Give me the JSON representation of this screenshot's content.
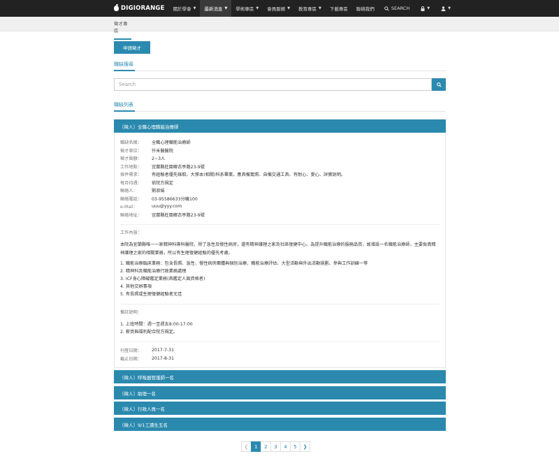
{
  "header": {
    "brand": "DIGIORANGE",
    "nav": [
      {
        "label": "關於學會",
        "caret": true,
        "active": false
      },
      {
        "label": "最新消息",
        "caret": true,
        "active": true
      },
      {
        "label": "學術專區",
        "caret": true,
        "active": false
      },
      {
        "label": "會員服務",
        "caret": true,
        "active": false
      },
      {
        "label": "教育專區",
        "caret": true,
        "active": false
      },
      {
        "label": "下載專區",
        "caret": false,
        "active": false
      },
      {
        "label": "聯絡我們",
        "caret": false,
        "active": false
      }
    ],
    "search_label": "SEARCH"
  },
  "breadcrumb": {
    "label": "徵才專區"
  },
  "apply_button": "申請徵才",
  "search_section": {
    "title": "職缺搜尋",
    "placeholder": "Search"
  },
  "list_section": {
    "title": "職缺列表"
  },
  "jobs": [
    {
      "title": "〔徵人〕全職心理職能治療師"
    },
    {
      "title": "〔徵人〕呼吸器管護師一名"
    },
    {
      "title": "〔徵人〕助理一名"
    },
    {
      "title": "〔徵人〕行政人員一名"
    },
    {
      "title": "〔徵人〕9/1工讀生五名"
    }
  ],
  "job_detail": {
    "fields": [
      {
        "k": "職缺名稱：",
        "v": "全職心理職能治療師"
      },
      {
        "k": "徵才單位：",
        "v": "仟禾醫醫院"
      },
      {
        "k": "徵才員額：",
        "v": "2~3人"
      },
      {
        "k": "工作地點：",
        "v": "宜蘭縣壯圍鄉古亭路23-9號"
      },
      {
        "k": "條件需求：",
        "v": "有經驗者優先錄取。大學本(相關)科系畢業。應具備駕照、自備交通工具、有耐心、愛心、詳實說明。"
      },
      {
        "k": "每月待遇：",
        "v": "依院方規定"
      },
      {
        "k": "聯絡人：",
        "v": "劉淑娟"
      },
      {
        "k": "聯絡電話：",
        "v": "03-95586633分機100"
      },
      {
        "k": "e-Mail：",
        "v": "uuu@yyy.com"
      },
      {
        "k": "聯絡地址：",
        "v": "宜蘭縣壯圍鄉古亭路23-9號"
      }
    ],
    "content_label": "工作內容：",
    "content_para": "本院為宜蘭縣唯一一家精神科專科醫院，除了急性及慢性病房，還有精神護理之家及社區復健中心。為提升職能治療的服務品質，故增設一名職能治療師，主要負責精神護理之家的相關業務，所以有生理復健經驗的優先考慮。",
    "content_items": [
      "1. 職能治療臨床業務：包含長照、急性、慢性病房團體與個別治療、職能治療評估、大型活動與外出活動規劃、參與工作訓練一等",
      "2. 精神科及職能治療行政業務處理",
      "3. ICF身心障礙鑑定業務(具鑑定人員資格者)",
      "4. 其他交辦事項",
      "5. 有長照或生理復健經驗者尤佳"
    ],
    "note_label": "備註說明：",
    "note_items": [
      "1. 上班時間：週一至週五8:00-17:00",
      "2. 薪資與福利配合院方規定。"
    ],
    "dates": [
      {
        "k": "刊登日期：",
        "v": "2017-7-31"
      },
      {
        "k": "截止日期：",
        "v": "2017-8-31"
      }
    ]
  },
  "pagination": {
    "prev": "❮",
    "next": "❯",
    "pages": [
      "1",
      "2",
      "3",
      "4",
      "5"
    ],
    "active": "1"
  }
}
